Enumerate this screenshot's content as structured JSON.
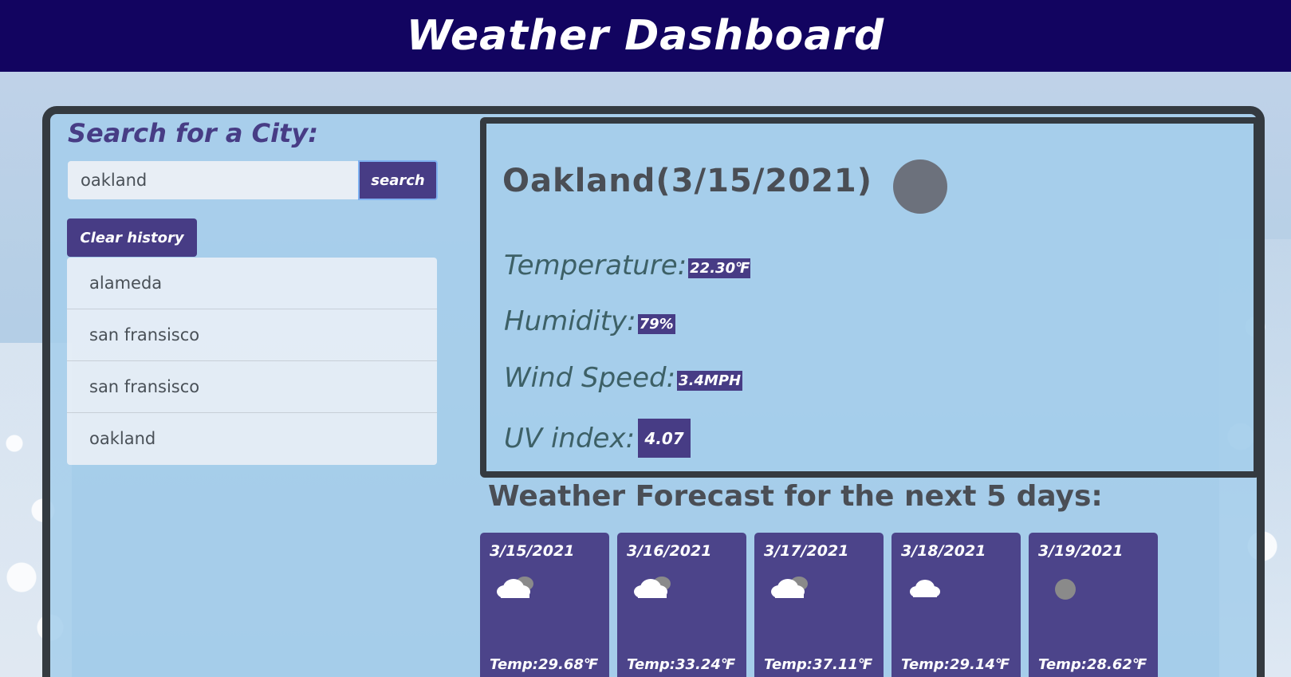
{
  "header": {
    "title": "Weather Dashboard"
  },
  "search": {
    "title": "Search for a City:",
    "input_value": "oakland",
    "button_label": "search",
    "clear_label": "Clear history",
    "history": [
      "alameda",
      "san fransisco",
      "san fransisco",
      "oakland"
    ]
  },
  "current": {
    "city_title": "Oakland(3/15/2021)",
    "icon": "moon-circle-icon",
    "temperature_label": "Temperature:",
    "temperature_value": "22.30℉",
    "humidity_label": "Humidity:",
    "humidity_value": "79%",
    "wind_label": "Wind Speed:",
    "wind_value": "3.4MPH",
    "uv_label": "UV index:",
    "uv_value": "4.07"
  },
  "forecast": {
    "title": "Weather Forecast for the next 5 days:",
    "days": [
      {
        "date": "3/15/2021",
        "icon": "broken-clouds-icon",
        "temp": "Temp:29.68℉"
      },
      {
        "date": "3/16/2021",
        "icon": "broken-clouds-icon",
        "temp": "Temp:33.24℉"
      },
      {
        "date": "3/17/2021",
        "icon": "broken-clouds-icon",
        "temp": "Temp:37.11℉"
      },
      {
        "date": "3/18/2021",
        "icon": "cloud-icon",
        "temp": "Temp:29.14℉"
      },
      {
        "date": "3/19/2021",
        "icon": "moon-circle-icon",
        "temp": "Temp:28.62℉"
      }
    ]
  },
  "colors": {
    "header_bg": "#120460",
    "accent": "#473c85",
    "border": "#343a40",
    "panel_bg": "#a5ceeb"
  }
}
